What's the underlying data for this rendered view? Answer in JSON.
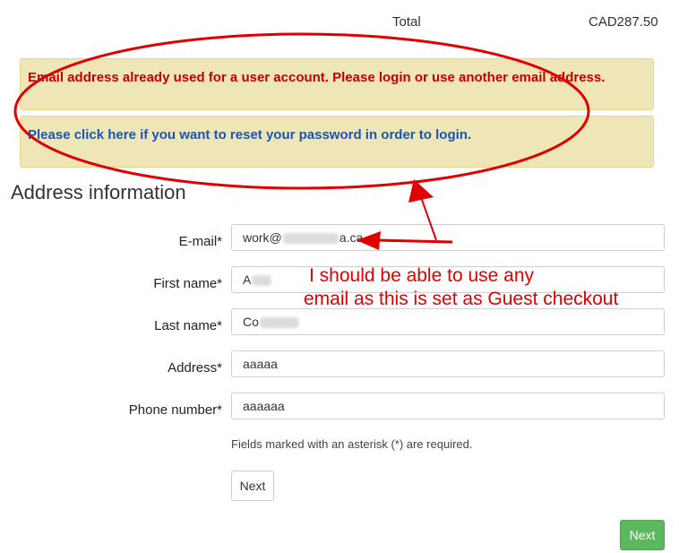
{
  "summary": {
    "total_label": "Total",
    "total_value": "CAD287.50"
  },
  "alerts": {
    "error": "Email address already used for a user account. Please login or use another email address.",
    "reset_link": "Please click here if you want to reset your password in order to login."
  },
  "section_title": "Address information",
  "form": {
    "email_label": "E-mail*",
    "email_value_prefix": "work@",
    "email_value_suffix": "a.ca",
    "first_name_label": "First name*",
    "first_name_value": "A",
    "last_name_label": "Last name*",
    "last_name_value": "Co",
    "address_label": "Address*",
    "address_value": "aaaaa",
    "phone_label": "Phone number*",
    "phone_value": "aaaaaa",
    "required_note": "Fields marked with an asterisk (*) are required.",
    "next_secondary": "Next",
    "next_primary": "Next"
  },
  "annotation": {
    "line1": "I should be able to use any",
    "line2": "email as this is set as Guest checkout",
    "color": "#e00000"
  },
  "colors": {
    "alert_bg": "#efe6b7",
    "error_text": "#c40000",
    "link_text": "#1a55b3",
    "primary_button": "#5cb85c"
  }
}
